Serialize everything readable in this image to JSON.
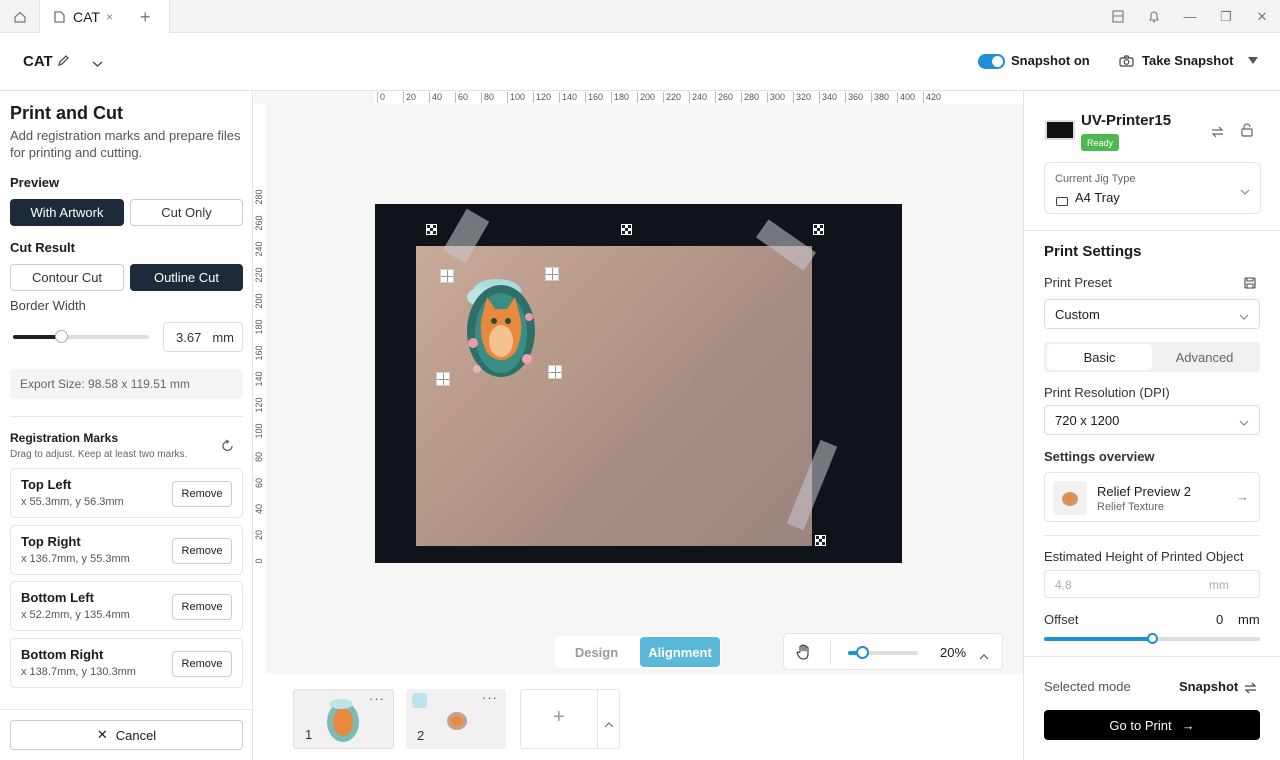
{
  "tabs": {
    "home_icon": "home-icon",
    "active_tab": "CAT",
    "close": "×",
    "add": "+"
  },
  "header": {
    "doc_title": "CAT",
    "snapshot_toggle_label": "Snapshot on",
    "snapshot_on": true,
    "take_snapshot_label": "Take Snapshot"
  },
  "left": {
    "title": "Print and Cut",
    "description": "Add registration marks and prepare files for printing and cutting.",
    "preview_heading": "Preview",
    "preview_options": [
      "With Artwork",
      "Cut Only"
    ],
    "preview_selected": "With Artwork",
    "cut_result_heading": "Cut Result",
    "cut_options": [
      "Contour Cut",
      "Outline Cut"
    ],
    "cut_selected": "Outline Cut",
    "border_width_label": "Border Width",
    "border_width_value": "3.67",
    "border_width_fraction": 0.35,
    "border_width_unit": "mm",
    "export_size": "Export Size: 98.58 x 119.51 mm",
    "reg_marks_heading": "Registration Marks",
    "reg_marks_hint": "Drag to adjust. Keep at least two marks.",
    "marks": [
      {
        "name": "Top Left",
        "coords": "x 55.3mm, y 56.3mm",
        "remove": "Remove"
      },
      {
        "name": "Top Right",
        "coords": "x 136.7mm, y 55.3mm",
        "remove": "Remove"
      },
      {
        "name": "Bottom Left",
        "coords": "x 52.2mm, y 135.4mm",
        "remove": "Remove"
      },
      {
        "name": "Bottom Right",
        "coords": "x 138.7mm, y 130.3mm",
        "remove": "Remove"
      }
    ],
    "cancel_label": "Cancel"
  },
  "canvas": {
    "ruler_top": [
      "0",
      "20",
      "40",
      "60",
      "80",
      "100",
      "120",
      "140",
      "160",
      "180",
      "200",
      "220",
      "240",
      "260",
      "280",
      "300",
      "320",
      "340",
      "360",
      "380",
      "400",
      "420"
    ],
    "ruler_left": [
      "280",
      "260",
      "240",
      "220",
      "200",
      "180",
      "160",
      "140",
      "120",
      "100",
      "80",
      "60",
      "40",
      "20",
      "0"
    ],
    "mode_tabs": [
      "Design",
      "Alignment"
    ],
    "mode_selected": "Alignment",
    "zoom_value": "20%",
    "zoom_fraction": 0.2,
    "thumbnails": [
      {
        "number": "1",
        "menu": "···"
      },
      {
        "number": "2",
        "menu": "···"
      }
    ],
    "add_label": "+"
  },
  "right": {
    "printer_name": "UV-Printer15",
    "status": "Ready",
    "status_color": "#4cb84f",
    "jig_label": "Current Jig Type",
    "jig_value": "A4 Tray",
    "print_settings_title": "Print Settings",
    "preset_label": "Print Preset",
    "preset_value": "Custom",
    "settings_tabs": [
      "Basic",
      "Advanced"
    ],
    "settings_selected": "Basic",
    "resolution_label": "Print Resolution (DPI)",
    "resolution_value": "720 x 1200",
    "overview_heading": "Settings overview",
    "overview_title": "Relief Preview 2",
    "overview_sub": "Relief Texture",
    "height_label": "Estimated Height of Printed Object",
    "height_placeholder": "4.8",
    "height_unit": "mm",
    "offset_label": "Offset",
    "offset_value": "0",
    "offset_unit": "mm",
    "offset_fraction": 0.5,
    "mode_label": "Selected mode",
    "mode_value": "Snapshot",
    "go_print_label": "Go to Print"
  },
  "colors": {
    "accent": "#1f8fd6",
    "dark_button": "#1d2a3a",
    "alignment_tab": "#5ab8d8"
  }
}
